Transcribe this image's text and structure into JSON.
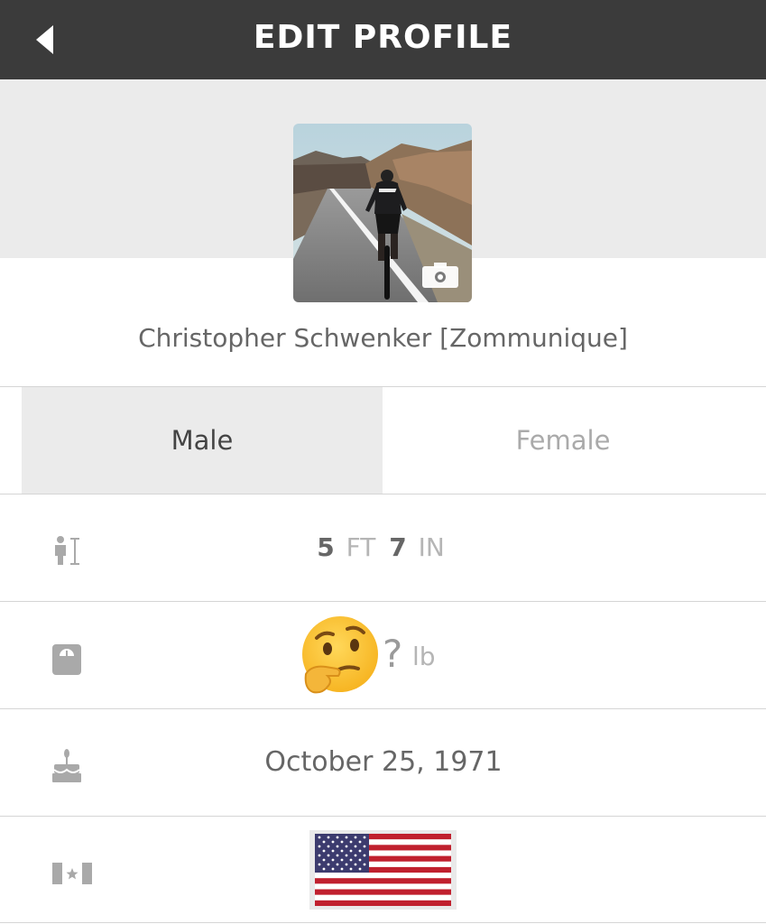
{
  "header": {
    "title": "EDIT PROFILE",
    "back_icon": "back-arrow-icon",
    "background": "#3b3b3b"
  },
  "profile": {
    "name": "Christopher Schwenker [Zommunique]",
    "photo_icon": "camera-icon"
  },
  "gender": {
    "options": [
      "Male",
      "Female"
    ],
    "selected": "Male"
  },
  "height": {
    "icon": "height-icon",
    "feet": "5",
    "feet_unit": "FT",
    "inches": "7",
    "inches_unit": "IN"
  },
  "weight": {
    "icon": "scale-icon",
    "emoji": "🤔",
    "value": "?",
    "unit": "lb"
  },
  "birthday": {
    "icon": "birthday-cake-icon",
    "value": "October 25, 1971"
  },
  "country": {
    "icon": "flag-icon",
    "flag": "united-states-flag"
  },
  "colors": {
    "banner": "#ebebeb",
    "selected_option": "#ebebeb",
    "separator": "#d5d5d5"
  }
}
